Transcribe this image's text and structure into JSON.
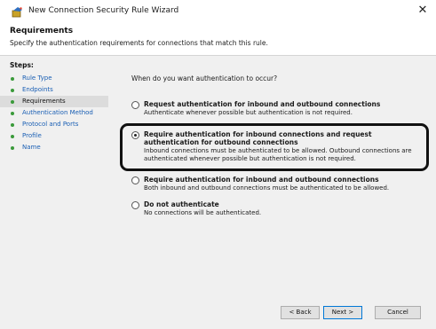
{
  "window": {
    "title": "New Connection Security Rule Wizard",
    "close_glyph": "✕",
    "app_icon": "wizard-icon"
  },
  "header": {
    "title": "Requirements",
    "subtitle": "Specify the authentication requirements for connections that match this rule."
  },
  "steps": {
    "title": "Steps:",
    "items": [
      {
        "label": "Rule Type",
        "active": false
      },
      {
        "label": "Endpoints",
        "active": false
      },
      {
        "label": "Requirements",
        "active": true
      },
      {
        "label": "Authentication Method",
        "active": false
      },
      {
        "label": "Protocol and Ports",
        "active": false
      },
      {
        "label": "Profile",
        "active": false
      },
      {
        "label": "Name",
        "active": false
      }
    ]
  },
  "content": {
    "question": "When do you want authentication to occur?",
    "options": [
      {
        "label": "Request authentication for inbound and outbound connections",
        "description": "Authenticate whenever possible but authentication is not required.",
        "selected": false
      },
      {
        "label": "Require authentication for inbound connections and request authentication for outbound connections",
        "description": "Inbound connections must be authenticated to be allowed. Outbound connections are authenticated whenever possible but authentication is not required.",
        "selected": true
      },
      {
        "label": "Require authentication for inbound and outbound connections",
        "description": "Both inbound and outbound connections must be authenticated to be allowed.",
        "selected": false
      },
      {
        "label": "Do not authenticate",
        "description": "No connections will be authenticated.",
        "selected": false
      }
    ]
  },
  "buttons": {
    "back": "< Back",
    "next": "Next >",
    "cancel": "Cancel"
  },
  "colors": {
    "link": "#1a5fb4",
    "step_dot": "#3a9a3a",
    "panel_bg": "#f0f0f0",
    "highlight": "#111111"
  }
}
